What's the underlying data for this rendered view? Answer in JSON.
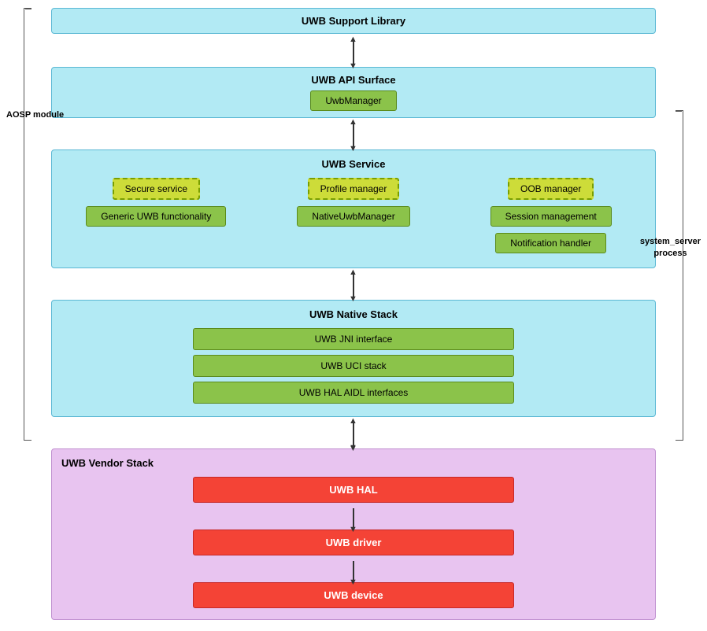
{
  "diagram": {
    "support_library": "UWB Support Library",
    "api_surface": {
      "title": "UWB API Surface",
      "uwb_manager": "UwbManager"
    },
    "uwb_service": {
      "title": "UWB Service",
      "row1": [
        "Secure service",
        "Profile manager",
        "OOB manager"
      ],
      "row2": [
        "Generic UWB functionality",
        "NativeUwbManager",
        "Session management"
      ],
      "row3": [
        "Notification handler"
      ]
    },
    "native_stack": {
      "title": "UWB Native Stack",
      "items": [
        "UWB JNI interface",
        "UWB UCI stack",
        "UWB HAL AIDL interfaces"
      ]
    },
    "vendor_stack": {
      "title": "UWB Vendor Stack",
      "items": [
        "UWB HAL",
        "UWB driver",
        "UWB device"
      ]
    },
    "side_labels": {
      "aosp": "AOSP module",
      "system_server": "system_server\nprocess"
    }
  }
}
